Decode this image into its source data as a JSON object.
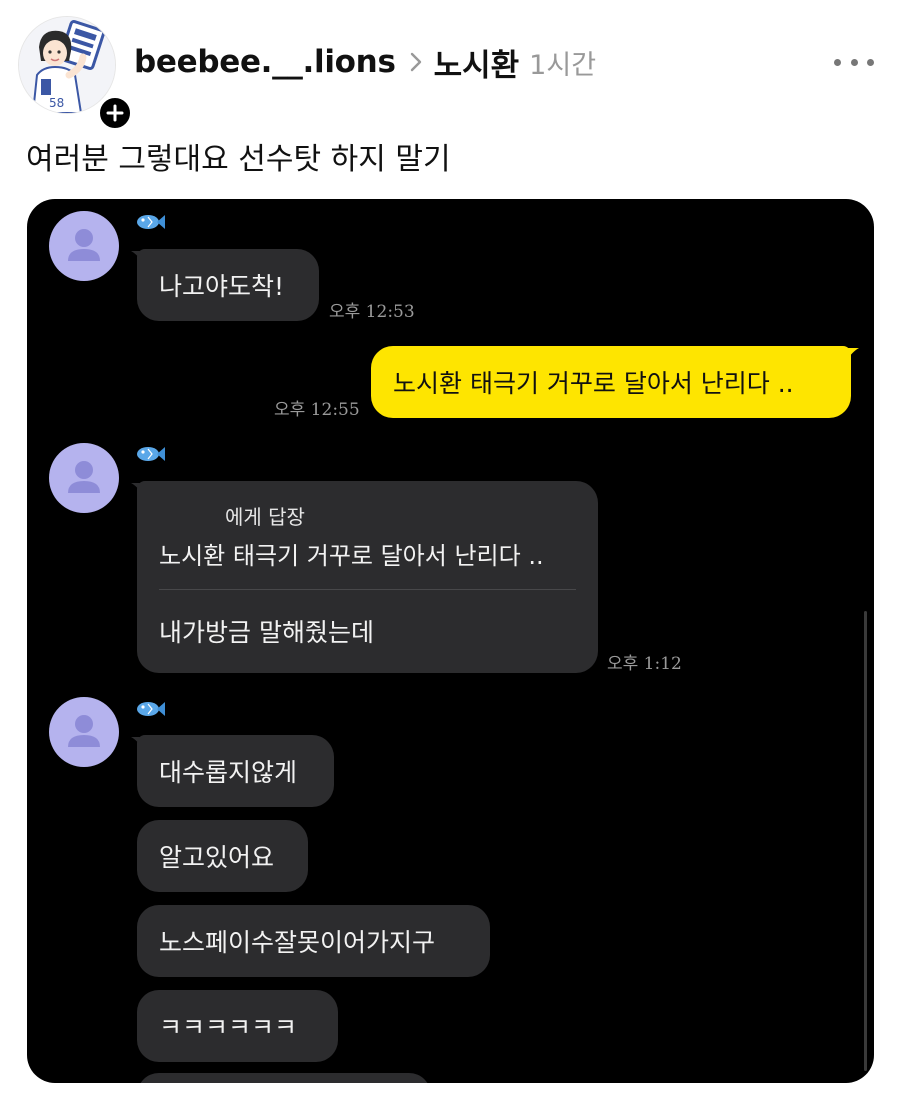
{
  "post": {
    "username": "beebee.__.lions",
    "topic": "노시환",
    "time": "1시간",
    "caption": "여러분 그렇대요 선수탓 하지 말기",
    "avatar_icon": "player-cartoon-avatar",
    "follow_icon": "plus-icon",
    "more_icon": "more-dots-icon"
  },
  "chat": {
    "theme": {
      "background": "#000000",
      "incoming_bubble": "#2c2c2e",
      "outgoing_bubble": "#fee500",
      "avatar": "#b5b3ee"
    },
    "sender_icon": "fish-icon",
    "group1": {
      "messages": [
        "나고야도착!"
      ],
      "time": "오후 12:53"
    },
    "outgoing": {
      "text": "노시환 태극기 거꾸로 달아서 난리다 ..",
      "time": "오후 12:55"
    },
    "group2": {
      "reply_to": "에게 답장",
      "quoted": "노시환 태극기 거꾸로 달아서 난리다 ..",
      "text": "내가방금 말해줬는데",
      "time": "오후 1:12"
    },
    "group3": {
      "messages": [
        "대수롭지않게",
        "알고있어요",
        "노스페이수잘못이어가지구",
        "ㅋㅋㅋㅋㅋㅋ"
      ]
    }
  }
}
